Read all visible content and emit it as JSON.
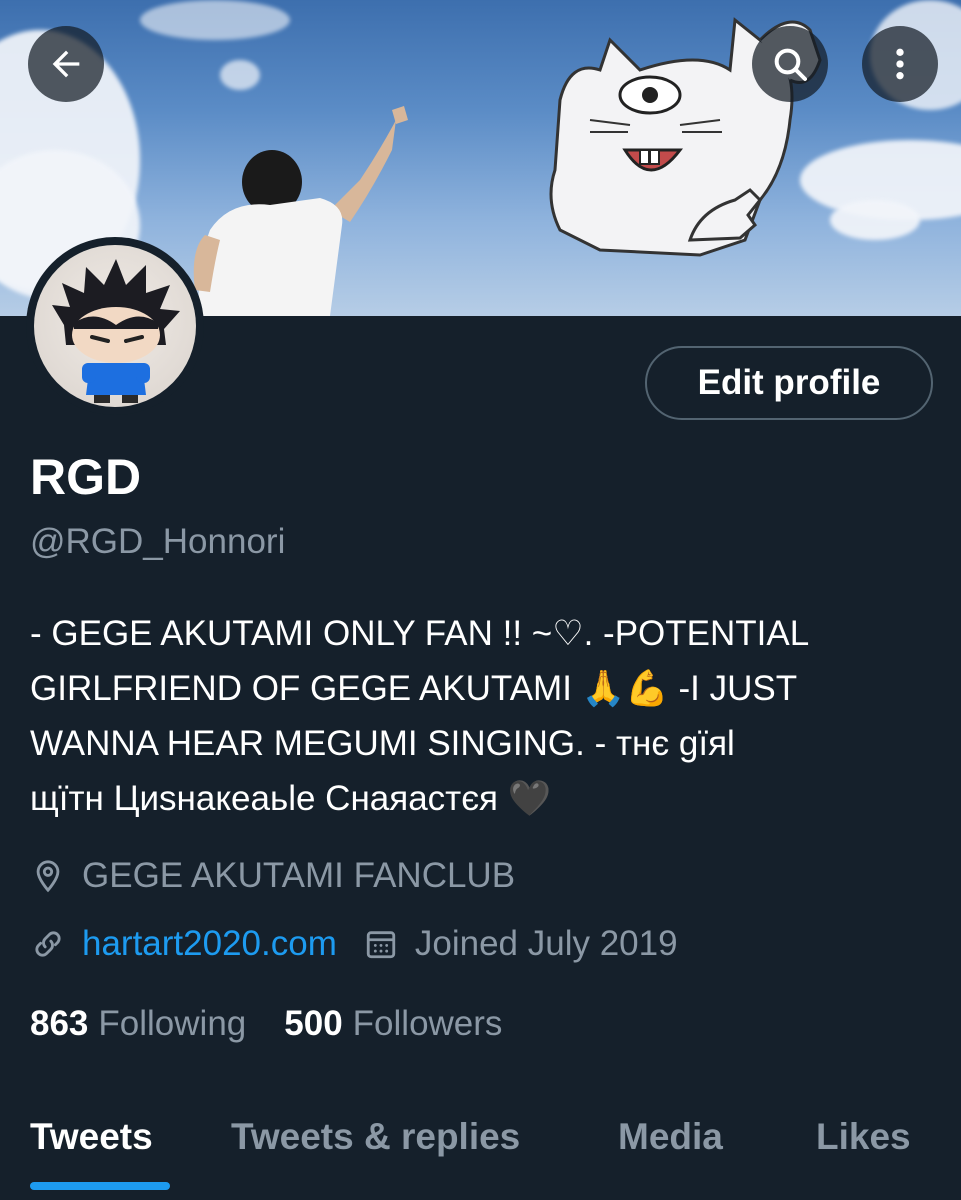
{
  "header": {
    "back_icon": "arrow-left-icon",
    "search_icon": "search-icon",
    "more_icon": "more-vertical-icon"
  },
  "profile": {
    "display_name": "RGD",
    "handle": "@RGD_Honnori",
    "edit_label": "Edit profile",
    "bio_line1": "- GEGE AKUTAMI ONLY FAN !! ~♡.  -POTENTIAL",
    "bio_line2": "GIRLFRIEND OF GEGE AKUTAMI 🙏💪   -I JUST",
    "bio_line3": "WANNA HEAR MEGUMI SINGING.  - тнє gїяl",
    "bio_line4": "щїтн Циѕнакеаьlе Снаяастєя 🖤",
    "location": "GEGE AKUTAMI FANCLUB",
    "website": "hartart2020.com",
    "joined": "Joined July 2019",
    "following_count": "863",
    "following_label": "Following",
    "followers_count": "500",
    "followers_label": "Followers"
  },
  "tabs": [
    {
      "label": "Tweets",
      "active": true
    },
    {
      "label": "Tweets & replies",
      "active": false
    },
    {
      "label": "Media",
      "active": false
    },
    {
      "label": "Likes",
      "active": false
    }
  ],
  "colors": {
    "background": "#15202b",
    "accent": "#1d9bf0",
    "secondary_text": "#8b98a5"
  }
}
